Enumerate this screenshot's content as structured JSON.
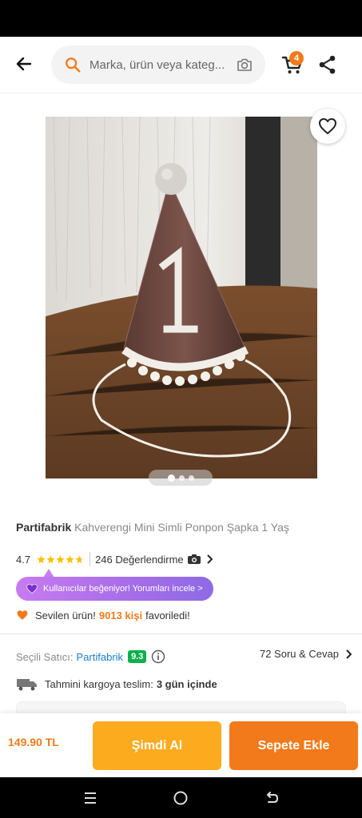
{
  "search": {
    "placeholder": "Marka, ürün veya kateg..."
  },
  "header": {
    "cart_count": "4"
  },
  "gallery": {
    "page_count": 3,
    "active_page": 1
  },
  "product": {
    "brand": "Partifabrik",
    "name": "Kahverengi Mini Simli Ponpon Şapka 1 Yaş",
    "rating": "4.7",
    "rating_stars": 4.7,
    "review_count": "246 Değerlendirme"
  },
  "promo_pill": {
    "label": "Kullanıcılar beğeniyor! Yorumları incele >"
  },
  "favorites": {
    "prefix": "Sevilen ürün!",
    "count": "9013 kişi",
    "suffix": "favoriledi!"
  },
  "seller": {
    "label": "Seçili Satıcı:",
    "name": "Partifabrik",
    "score": "9.3"
  },
  "qa": {
    "label": "72 Soru & Cevap"
  },
  "shipping": {
    "label": "Tahmini kargoya teslim:",
    "value": "3 gün içinde"
  },
  "bottom": {
    "price": "149.90 TL",
    "buy_now": "Şimdi Al",
    "add_to_cart": "Sepete Ekle"
  },
  "colors": {
    "accent": "#f27a1a",
    "buy_button": "#fcab1f",
    "seller_link": "#1a7fd5",
    "score_badge": "#0bb04b",
    "pill_gradient_start": "#c77bf0"
  },
  "icons": [
    "back-arrow-icon",
    "search-icon",
    "camera-icon",
    "cart-icon",
    "share-icon",
    "heart-icon",
    "star-icon",
    "photo-icon",
    "chevron-right-icon",
    "purple-heart-icon",
    "orange-heart-icon",
    "info-icon",
    "truck-icon",
    "menu-icon",
    "home-icon",
    "back-icon"
  ]
}
